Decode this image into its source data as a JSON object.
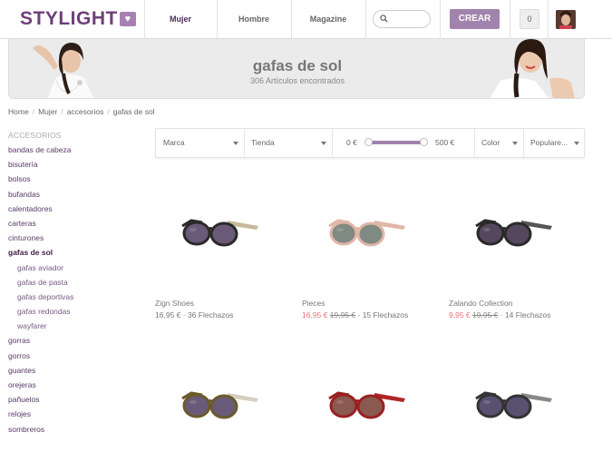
{
  "header": {
    "logo_text": "STYLIGHT",
    "nav": [
      "Mujer",
      "Hombre",
      "Magazine"
    ],
    "search_placeholder": "",
    "create_label": "CREAR",
    "count": "0"
  },
  "banner": {
    "title": "gafas de sol",
    "subtitle": "306 Artículos encontrados"
  },
  "breadcrumb": [
    "Home",
    "Mujer",
    "accesorios",
    "gafas de sol"
  ],
  "sidebar": {
    "heading": "ACCESORIOS",
    "items": [
      {
        "label": "bandas de cabeza",
        "level": 0
      },
      {
        "label": "bisutería",
        "level": 0
      },
      {
        "label": "bolsos",
        "level": 0
      },
      {
        "label": "bufandas",
        "level": 0
      },
      {
        "label": "calentadores",
        "level": 0
      },
      {
        "label": "carteras",
        "level": 0
      },
      {
        "label": "cinturones",
        "level": 0
      },
      {
        "label": "gafas de sol",
        "level": 0,
        "active": true
      },
      {
        "label": "gafas aviador",
        "level": 1
      },
      {
        "label": "gafas de pasta",
        "level": 1
      },
      {
        "label": "gafas deportivas",
        "level": 1
      },
      {
        "label": "gafas redondas",
        "level": 1
      },
      {
        "label": "wayfarer",
        "level": 1
      },
      {
        "label": "gorras",
        "level": 0
      },
      {
        "label": "gorros",
        "level": 0
      },
      {
        "label": "guantes",
        "level": 0
      },
      {
        "label": "orejeras",
        "level": 0
      },
      {
        "label": "pañuelos",
        "level": 0
      },
      {
        "label": "relojes",
        "level": 0
      },
      {
        "label": "sombreros",
        "level": 0
      }
    ]
  },
  "filters": {
    "brand": "Marca",
    "store": "Tienda",
    "price_min": "0 €",
    "price_max": "500 €",
    "color": "Color",
    "sort": "Populare..."
  },
  "products": [
    {
      "name": "Zign Shoes",
      "price": "16,95 €",
      "old_price": "",
      "likes": "· 36 Flechazos",
      "frame": "#2a2a2a",
      "temple": "#c8b79a",
      "lens": "#6a5a78"
    },
    {
      "name": "Pieces",
      "price": "16,95 €",
      "old_price": "19,95 €",
      "likes": "· 15 Flechazos",
      "frame": "#e0b6a6",
      "temple": "#e0b6a6",
      "lens": "#7f8a82"
    },
    {
      "name": "Zalando Collection",
      "price": "9,95 €",
      "old_price": "19,95 €",
      "likes": "· 14 Flechazos",
      "frame": "#2a2a2a",
      "temple": "#555555",
      "lens": "#55485e"
    },
    {
      "name": "",
      "price": "",
      "old_price": "",
      "likes": "",
      "frame": "#6b5a2a",
      "temple": "#d8cfc0",
      "lens": "#6a5a7a"
    },
    {
      "name": "",
      "price": "",
      "old_price": "",
      "likes": "",
      "frame": "#9a2020",
      "temple": "#b02525",
      "lens": "#8a5a50"
    },
    {
      "name": "",
      "price": "",
      "old_price": "",
      "likes": "",
      "frame": "#333333",
      "temple": "#888888",
      "lens": "#5a5070"
    }
  ]
}
